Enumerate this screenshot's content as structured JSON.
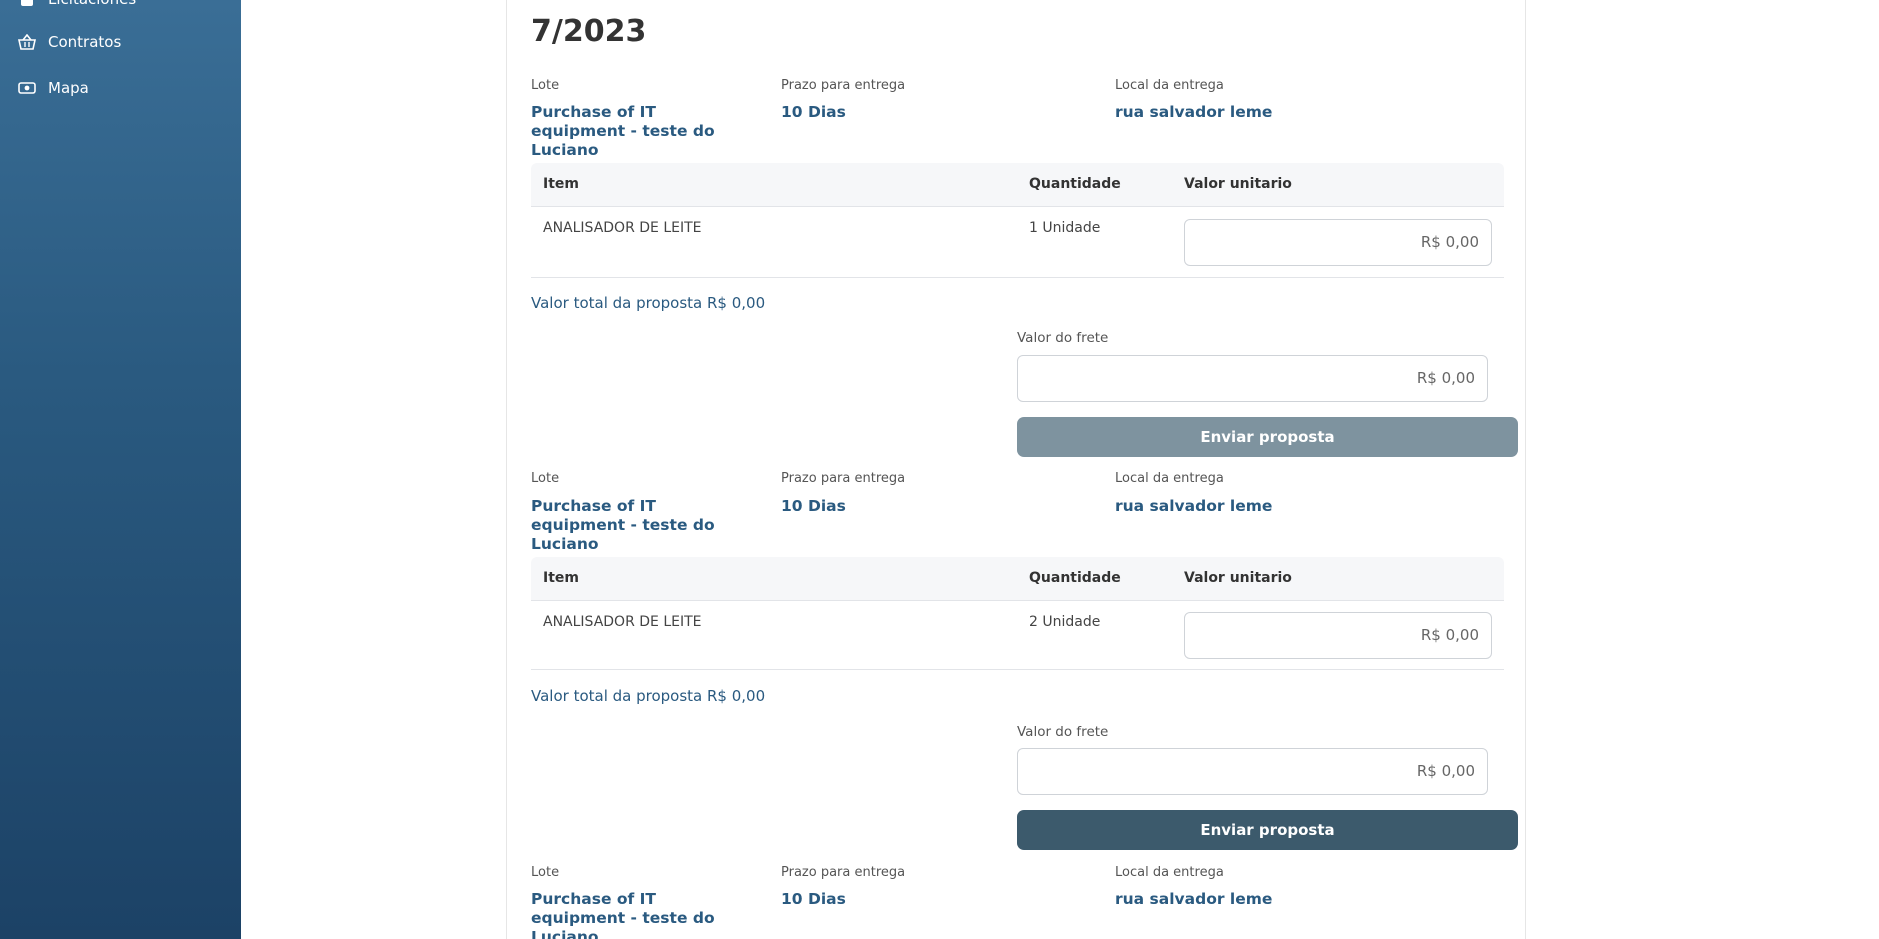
{
  "sidebar": {
    "items": [
      {
        "label": "Licitaciones",
        "icon": "document-icon"
      },
      {
        "label": "Contratos",
        "icon": "basket-icon"
      },
      {
        "label": "Mapa",
        "icon": "map-money-icon"
      }
    ]
  },
  "page": {
    "title": "7/2023"
  },
  "lots": [
    {
      "lote_label": "Lote",
      "lote_value": "Purchase of IT equipment - teste do Luciano",
      "prazo_label": "Prazo para entrega",
      "prazo_value": "10 Dias",
      "local_label": "Local da entrega",
      "local_value": "rua salvador leme",
      "table": {
        "headers": {
          "item": "Item",
          "quantidade": "Quantidade",
          "valor": "Valor unitario"
        },
        "rows": [
          {
            "item": "ANALISADOR DE LEITE",
            "quantidade": "1 Unidade",
            "valor": "R$ 0,00"
          }
        ]
      },
      "total": "Valor total da proposta R$  0,00",
      "frete_label": "Valor do frete",
      "frete_value": "R$ 0,00",
      "button": "Enviar proposta",
      "button_state": "disabled"
    },
    {
      "lote_label": "Lote",
      "lote_value": "Purchase of IT equipment - teste do Luciano",
      "prazo_label": "Prazo para entrega",
      "prazo_value": "10 Dias",
      "local_label": "Local da entrega",
      "local_value": "rua salvador leme",
      "table": {
        "headers": {
          "item": "Item",
          "quantidade": "Quantidade",
          "valor": "Valor unitario"
        },
        "rows": [
          {
            "item": "ANALISADOR DE LEITE",
            "quantidade": "2 Unidade",
            "valor": "R$ 0,00"
          }
        ]
      },
      "total": "Valor total da proposta R$  0,00",
      "frete_label": "Valor do frete",
      "frete_value": "R$ 0,00",
      "button": "Enviar proposta",
      "button_state": "enabled"
    },
    {
      "lote_label": "Lote",
      "lote_value": "Purchase of IT equipment - teste do Luciano",
      "prazo_label": "Prazo para entrega",
      "prazo_value": "10 Dias",
      "local_label": "Local da entrega",
      "local_value": "rua salvador leme"
    }
  ],
  "colors": {
    "sidebar_top": "#3a6e96",
    "sidebar_bottom": "#1c4266",
    "accent_text": "#2a5a80",
    "button_disabled": "#7e939f",
    "button_enabled": "#3c5a6c"
  }
}
